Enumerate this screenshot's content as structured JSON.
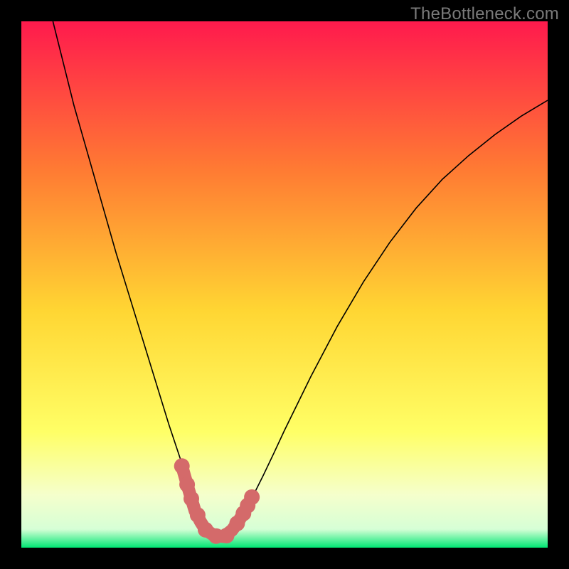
{
  "watermark": "TheBottleneck.com",
  "chart_data": {
    "type": "line",
    "title": "",
    "xlabel": "",
    "ylabel": "",
    "xlim": [
      0,
      100
    ],
    "ylim": [
      0,
      100
    ],
    "grid": false,
    "background_gradient": {
      "top": "#ff1a4d",
      "upper_mid": "#ff7a33",
      "mid": "#ffd633",
      "lower_mid": "#ffff66",
      "pale": "#f5ffcc",
      "bottom": "#00e673"
    },
    "series": [
      {
        "name": "bottleneck-curve",
        "color": "#000000",
        "width": 1.6,
        "x": [
          6,
          8,
          10,
          12,
          14,
          16,
          18,
          20,
          22,
          24,
          26,
          28,
          30,
          31,
          32,
          33,
          34,
          35,
          36,
          37,
          38,
          39,
          40,
          42,
          44,
          46,
          48,
          50,
          55,
          60,
          65,
          70,
          75,
          80,
          85,
          90,
          95,
          100
        ],
        "y": [
          100,
          92,
          84,
          77,
          70,
          63,
          56,
          49.5,
          43,
          36.5,
          30,
          23.5,
          17.5,
          14.5,
          12,
          9.5,
          7.3,
          5.4,
          3.8,
          2.6,
          2.0,
          2.3,
          3.3,
          6.2,
          9.8,
          13.8,
          18.0,
          22.3,
          32.5,
          42.0,
          50.5,
          58.0,
          64.5,
          70.0,
          74.5,
          78.5,
          82.0,
          85.0
        ]
      }
    ],
    "highlight_segment": {
      "color": "#d46a6a",
      "width": 9,
      "x": [
        30.5,
        31.5,
        32.3,
        33.0,
        34.0,
        35.0,
        36.5,
        38.5,
        40.0,
        41.0,
        42.0,
        43.0,
        43.8
      ],
      "y": [
        15.5,
        12.0,
        9.3,
        7.0,
        5.0,
        3.4,
        2.4,
        2.1,
        3.3,
        4.6,
        6.2,
        8.0,
        9.6
      ]
    },
    "highlight_dots": {
      "color": "#d46a6a",
      "radius": 5.5,
      "points": [
        {
          "x": 30.5,
          "y": 15.5
        },
        {
          "x": 31.5,
          "y": 12.0
        },
        {
          "x": 32.3,
          "y": 9.3
        },
        {
          "x": 33.5,
          "y": 6.2
        },
        {
          "x": 35.0,
          "y": 3.4
        },
        {
          "x": 37.0,
          "y": 2.2
        },
        {
          "x": 39.0,
          "y": 2.3
        },
        {
          "x": 41.0,
          "y": 4.6
        },
        {
          "x": 42.2,
          "y": 6.5
        },
        {
          "x": 43.0,
          "y": 8.0
        },
        {
          "x": 43.8,
          "y": 9.6
        }
      ]
    }
  }
}
